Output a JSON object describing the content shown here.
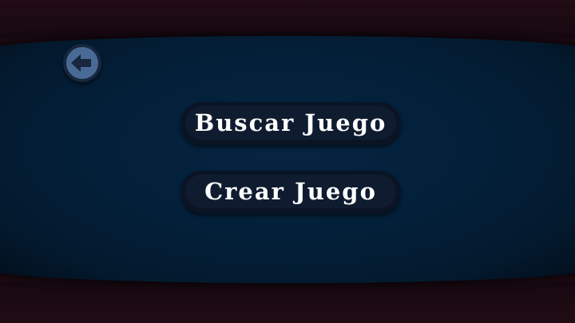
{
  "menu": {
    "buttons": [
      {
        "label": "Buscar Juego"
      },
      {
        "label": "Crear Juego"
      }
    ]
  },
  "icons": {
    "back": "arrow-left-icon"
  }
}
